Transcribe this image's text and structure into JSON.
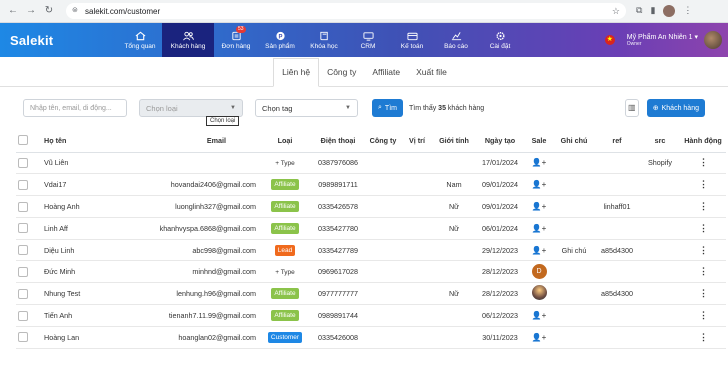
{
  "browser": {
    "url": "salekit.com/customer"
  },
  "app": {
    "logo": "Salekit",
    "menu": [
      {
        "label": "Tổng quan",
        "icon": "home-icon",
        "active": false
      },
      {
        "label": "Khách hàng",
        "icon": "users-icon",
        "active": true
      },
      {
        "label": "Đơn hàng",
        "icon": "order-icon",
        "active": false,
        "badge": "53"
      },
      {
        "label": "Sản phẩm",
        "icon": "product-icon",
        "active": false
      },
      {
        "label": "Khóa học",
        "icon": "book-icon",
        "active": false
      },
      {
        "label": "CRM",
        "icon": "crm-icon",
        "active": false
      },
      {
        "label": "Kế toán",
        "icon": "wallet-icon",
        "active": false
      },
      {
        "label": "Báo cáo",
        "icon": "chart-icon",
        "active": false
      },
      {
        "label": "Cài đặt",
        "icon": "gear-icon",
        "active": false
      }
    ],
    "store_name": "Mỹ Phẩm An Nhiên 1",
    "store_role": "Owner"
  },
  "tabs": [
    "Liên hệ",
    "Công ty",
    "Affiliate",
    "Xuất file"
  ],
  "filters": {
    "search_placeholder": "Nhập tên, email, di động...",
    "type_placeholder": "Chọn loại",
    "tag_placeholder": "Chọn tag",
    "search_button": "Tìm",
    "found_prefix": "Tìm thấy",
    "found_count": "35",
    "found_suffix": "khách hàng",
    "tooltip": "Chọn loại",
    "add_button": "Khách hàng"
  },
  "table": {
    "headers": [
      "Họ tên",
      "Email",
      "Loại",
      "Điện thoại",
      "Công ty",
      "Vị trí",
      "Giới tính",
      "Ngày tạo",
      "Sale",
      "Ghi chú",
      "ref",
      "src",
      "Hành động"
    ],
    "rows": [
      {
        "name": "Vũ Liên",
        "email": "",
        "type": "+ Type",
        "type_kind": "add",
        "phone": "0387976086",
        "company": "",
        "position": "",
        "gender": "",
        "created": "17/01/2024",
        "sale": "add",
        "note": "",
        "ref": "",
        "src": "Shopify"
      },
      {
        "name": "Vdai17",
        "email": "hovandai2406@gmail.com",
        "type": "Affiliate",
        "type_kind": "affiliate",
        "phone": "0989891711",
        "company": "",
        "position": "",
        "gender": "Nam",
        "created": "09/01/2024",
        "sale": "add",
        "note": "",
        "ref": "",
        "src": ""
      },
      {
        "name": "Hoàng Anh",
        "email": "luonglinh327@gmail.com",
        "type": "Affiliate",
        "type_kind": "affiliate",
        "phone": "0335426578",
        "company": "",
        "position": "",
        "gender": "Nữ",
        "created": "09/01/2024",
        "sale": "add",
        "note": "",
        "ref": "linhaff01",
        "src": ""
      },
      {
        "name": "Linh Aff",
        "email": "khanhvyspa.6868@gmail.com",
        "type": "Affiliate",
        "type_kind": "affiliate",
        "phone": "0335427780",
        "company": "",
        "position": "",
        "gender": "Nữ",
        "created": "06/01/2024",
        "sale": "add",
        "note": "",
        "ref": "",
        "src": ""
      },
      {
        "name": "Diệu Linh",
        "email": "abc998@gmail.com",
        "type": "Lead",
        "type_kind": "lead",
        "phone": "0335427789",
        "company": "",
        "position": "",
        "gender": "",
        "created": "29/12/2023",
        "sale": "add",
        "note": "Ghi chú",
        "ref": "a85d4300",
        "src": ""
      },
      {
        "name": "Đức Minh",
        "email": "minhnd@gmail.com",
        "type": "+ Type",
        "type_kind": "add",
        "phone": "0969617028",
        "company": "",
        "position": "",
        "gender": "",
        "created": "28/12/2023",
        "sale": "D",
        "note": "",
        "ref": "",
        "src": ""
      },
      {
        "name": "Nhung Test",
        "email": "lenhung.h96@gmail.com",
        "type": "Affiliate",
        "type_kind": "affiliate",
        "phone": "0977777777",
        "company": "",
        "position": "",
        "gender": "Nữ",
        "created": "28/12/2023",
        "sale": "avatar",
        "note": "",
        "ref": "a85d4300",
        "src": ""
      },
      {
        "name": "Tiến Anh",
        "email": "tienanh7.11.99@gmail.com",
        "type": "Affiliate",
        "type_kind": "affiliate",
        "phone": "0989891744",
        "company": "",
        "position": "",
        "gender": "",
        "created": "06/12/2023",
        "sale": "add",
        "note": "",
        "ref": "",
        "src": ""
      },
      {
        "name": "Hoàng Lan",
        "email": "hoanglan02@gmail.com",
        "type": "Customer",
        "type_kind": "customer",
        "phone": "0335426008",
        "company": "",
        "position": "",
        "gender": "",
        "created": "30/11/2023",
        "sale": "add",
        "note": "",
        "ref": "",
        "src": ""
      }
    ]
  },
  "colors": {
    "affiliate": "#8bc34a",
    "lead": "#f06a1d",
    "customer": "#1e88e5",
    "primary": "#1e7bd3"
  }
}
